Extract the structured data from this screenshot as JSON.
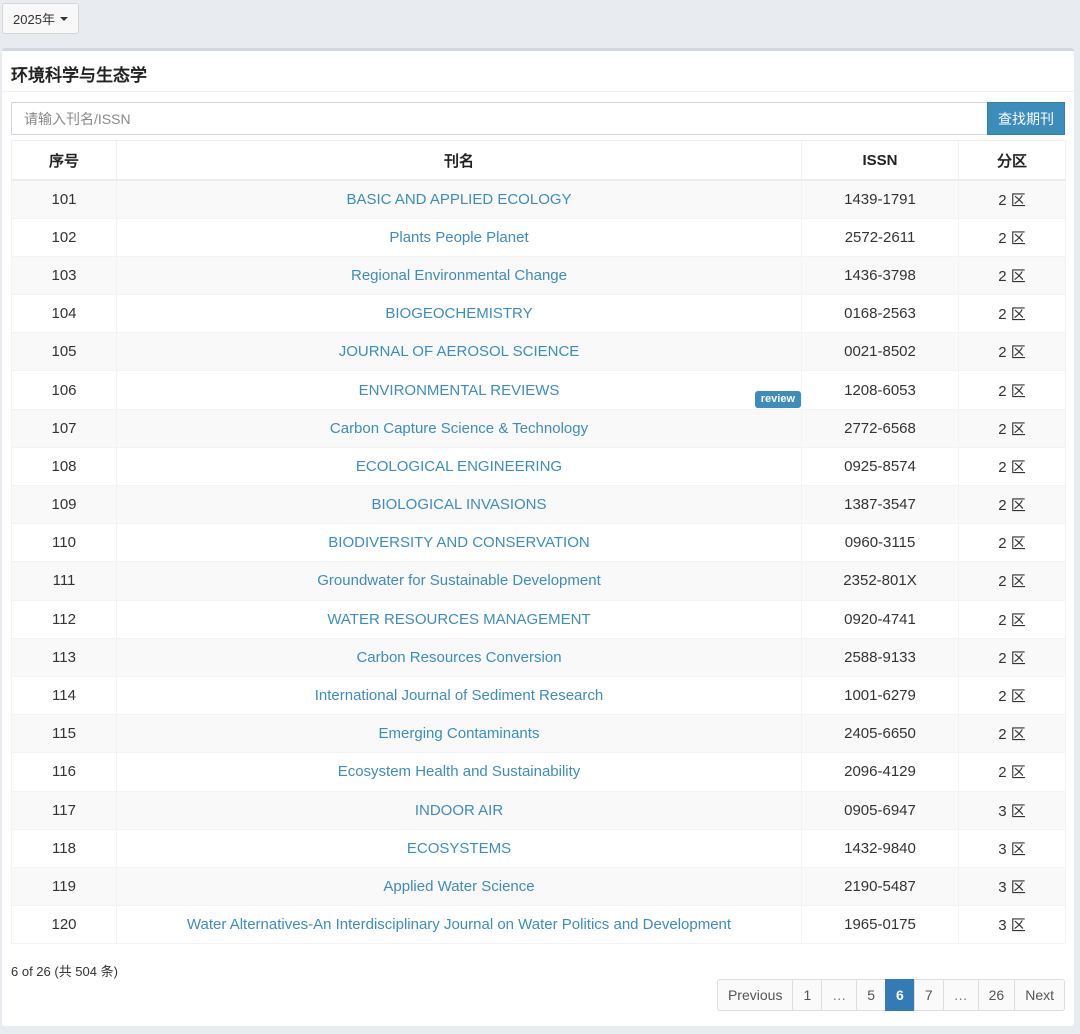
{
  "year_dropdown": {
    "label": "2025年"
  },
  "panel": {
    "title": "环境科学与生态学"
  },
  "search": {
    "placeholder": "请输入刊名/ISSN",
    "button_label": "查找期刊"
  },
  "table": {
    "headers": {
      "no": "序号",
      "name": "刊名",
      "issn": "ISSN",
      "zone": "分区"
    },
    "rows": [
      {
        "no": "101",
        "name": "BASIC AND APPLIED ECOLOGY",
        "issn": "1439-1791",
        "zone": "2 区"
      },
      {
        "no": "102",
        "name": "Plants People Planet",
        "issn": "2572-2611",
        "zone": "2 区"
      },
      {
        "no": "103",
        "name": "Regional Environmental Change",
        "issn": "1436-3798",
        "zone": "2 区"
      },
      {
        "no": "104",
        "name": "BIOGEOCHEMISTRY",
        "issn": "0168-2563",
        "zone": "2 区"
      },
      {
        "no": "105",
        "name": "JOURNAL OF AEROSOL SCIENCE",
        "issn": "0021-8502",
        "zone": "2 区"
      },
      {
        "no": "106",
        "name": "ENVIRONMENTAL REVIEWS",
        "issn": "1208-6053",
        "zone": "2 区",
        "badge": "review"
      },
      {
        "no": "107",
        "name": "Carbon Capture Science & Technology",
        "issn": "2772-6568",
        "zone": "2 区"
      },
      {
        "no": "108",
        "name": "ECOLOGICAL ENGINEERING",
        "issn": "0925-8574",
        "zone": "2 区"
      },
      {
        "no": "109",
        "name": "BIOLOGICAL INVASIONS",
        "issn": "1387-3547",
        "zone": "2 区"
      },
      {
        "no": "110",
        "name": "BIODIVERSITY AND CONSERVATION",
        "issn": "0960-3115",
        "zone": "2 区"
      },
      {
        "no": "111",
        "name": "Groundwater for Sustainable Development",
        "issn": "2352-801X",
        "zone": "2 区"
      },
      {
        "no": "112",
        "name": "WATER RESOURCES MANAGEMENT",
        "issn": "0920-4741",
        "zone": "2 区"
      },
      {
        "no": "113",
        "name": "Carbon Resources Conversion",
        "issn": "2588-9133",
        "zone": "2 区"
      },
      {
        "no": "114",
        "name": "International Journal of Sediment Research",
        "issn": "1001-6279",
        "zone": "2 区"
      },
      {
        "no": "115",
        "name": "Emerging Contaminants",
        "issn": "2405-6650",
        "zone": "2 区"
      },
      {
        "no": "116",
        "name": "Ecosystem Health and Sustainability",
        "issn": "2096-4129",
        "zone": "2 区"
      },
      {
        "no": "117",
        "name": "INDOOR AIR",
        "issn": "0905-6947",
        "zone": "3 区"
      },
      {
        "no": "118",
        "name": "ECOSYSTEMS",
        "issn": "1432-9840",
        "zone": "3 区"
      },
      {
        "no": "119",
        "name": "Applied Water Science",
        "issn": "2190-5487",
        "zone": "3 区"
      },
      {
        "no": "120",
        "name": "Water Alternatives-An Interdisciplinary Journal on Water Politics and Development",
        "issn": "1965-0175",
        "zone": "3 区"
      }
    ]
  },
  "footer": {
    "page_info": "6 of 26 (共 504 条)",
    "pagination": {
      "previous": "Previous",
      "p1": "1",
      "ellipsis_left": "…",
      "p5": "5",
      "p6": "6",
      "p7": "7",
      "ellipsis_right": "…",
      "p26": "26",
      "next": "Next"
    }
  },
  "colors": {
    "accent": "#3c8dbc",
    "active_page": "#337ab7"
  }
}
